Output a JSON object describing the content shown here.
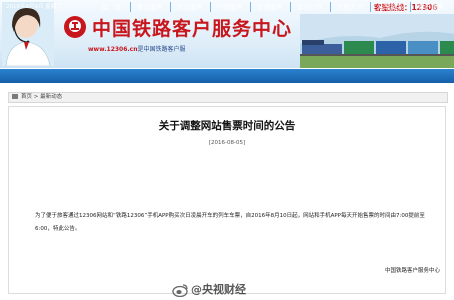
{
  "header": {
    "site_title": "中国铁路客户服务中心",
    "url": "www.12306.cn",
    "url_suffix": "是中国铁路客户服",
    "hotline": "客服热线：12306"
  },
  "nav": {
    "date": "2016年8月9日 星期二",
    "items": [
      "首　页",
      "客运服务",
      "货运服务",
      "行包服务",
      "旅游服务",
      "车站引导",
      "铁路常识",
      "站车风采",
      "客户服务"
    ]
  },
  "breadcrumb": {
    "home": "首页",
    "sep": " > ",
    "current": "最新动态"
  },
  "article": {
    "title": "关于调整网站售票时间的公告",
    "date": "[2016-08-05]",
    "body": "为了便于旅客通过12306网站和“铁路12306”手机APP购买次日凌晨开车的列车车票，自2016年8月10日起，网站和手机APP每天开始售票的时间由7:00提前至6:00，特此公告。",
    "signature": "中国铁路客户服务中心"
  },
  "watermark": {
    "text": "@央视财经"
  },
  "colors": {
    "brand_red": "#c8161d",
    "nav_blue": "#1a6bb8",
    "url_blue": "#2a4a8a"
  },
  "icons": {
    "logo": "railway-logo-icon",
    "home": "home-icon",
    "watermark": "weibo-icon"
  }
}
